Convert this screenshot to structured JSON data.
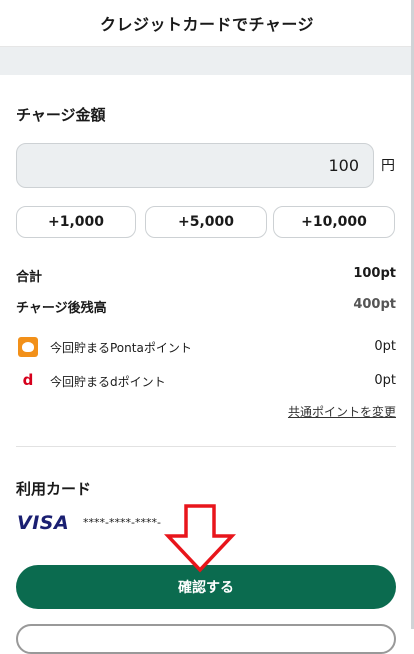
{
  "header": {
    "title": "クレジットカードでチャージ"
  },
  "charge": {
    "section_title": "チャージ金額",
    "amount_value": "100",
    "currency_unit": "円",
    "quick_amounts": [
      "+1,000",
      "+5,000",
      "+10,000"
    ]
  },
  "summary": {
    "total_label": "合計",
    "total_value": "100pt",
    "balance_label": "チャージ後残高",
    "balance_value": "400pt"
  },
  "points": {
    "ponta_label": "今回貯まるPontaポイント",
    "ponta_value": "0pt",
    "ponta_icon_text": "Ponta",
    "dpoint_label": "今回貯まるdポイント",
    "dpoint_value": "0pt",
    "dpoint_icon_text": "d",
    "change_link": "共通ポイントを変更"
  },
  "card": {
    "section_title": "利用カード",
    "brand": "VISA",
    "number": "****-****-****-"
  },
  "actions": {
    "confirm_label": "確認する"
  },
  "colors": {
    "primary": "#0b6b4f",
    "annotation_arrow": "#e8151b",
    "visa_blue": "#1a1f71"
  }
}
